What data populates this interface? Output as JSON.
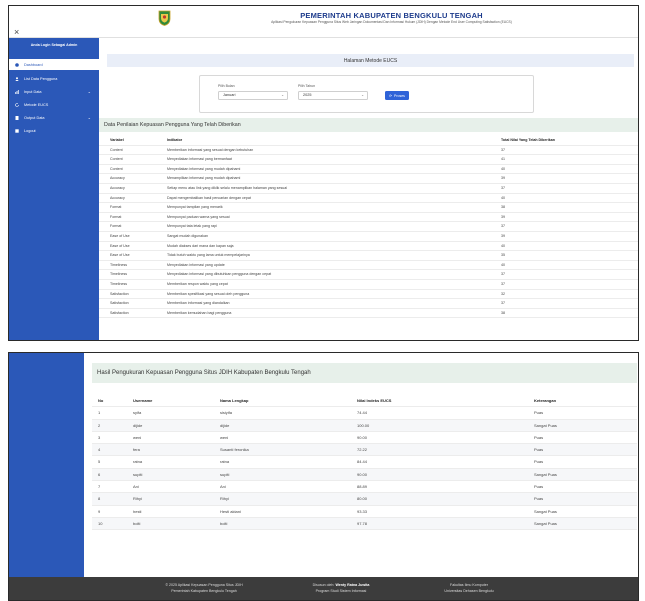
{
  "header": {
    "close_glyph": "×",
    "title": "PEMERINTAH KABUPATEN BENGKULU TENGAH",
    "subtitle": "Aplikasi Pengukuran Kepuasan Pengguna Situs Web Jaringan Dokumentasi Dan Informasi Hukum (JDIH) Dengan Metode End User Computing Satisfaction (EUCS)"
  },
  "sidebar": {
    "brand": "Anda Login Sebagai Admin",
    "items": [
      {
        "label": "Dashboard",
        "icon": "dashboard-icon"
      },
      {
        "label": "List Data Pengguna",
        "icon": "user-icon"
      },
      {
        "label": "Input Data",
        "icon": "chart-icon",
        "chevron": "⌄"
      },
      {
        "label": "Metode EUCS",
        "icon": "refresh-icon"
      },
      {
        "label": "Output Data",
        "icon": "document-icon",
        "chevron": "⌄"
      },
      {
        "label": "Logout",
        "icon": "logout-icon"
      }
    ]
  },
  "main": {
    "page_heading": "Halaman Metode EUCS",
    "filter": {
      "month_label": "Pilih Bulan",
      "month_value": "Januari",
      "year_label": "Pilih Tahun",
      "year_value": "2025",
      "button_label": "Proses"
    },
    "section_title": "Data Penilaian Kepuasan Pengguna Yang Telah Diberikan",
    "table": {
      "headers": [
        "Variabel",
        "Indikator",
        "Total Nilai Yang Telah Diberikan"
      ],
      "rows": [
        [
          "Content",
          "Memberikan informasi yang sesuai dengan kebutuhan",
          "37"
        ],
        [
          "Content",
          "Menyediakan informasi yang bermanfaat",
          "41"
        ],
        [
          "Content",
          "Menyediakan informasi yang mudah dipahami",
          "40"
        ],
        [
          "Accuracy",
          "Menampilkan informasi yang mudah dipahami",
          "39"
        ],
        [
          "Accuracy",
          "Setiap menu atau link yang diklik selalu menampilkan halaman yang sesuai",
          "37"
        ],
        [
          "Accuracy",
          "Dapat mengembalikan hasil pencarian dengan cepat",
          "40"
        ],
        [
          "Format",
          "Mempunyai tampilan yang menarik",
          "38"
        ],
        [
          "Format",
          "Mempunyai paduan warna yang sesuai",
          "39"
        ],
        [
          "Format",
          "Mempunyai tata letak yang rapi",
          "37"
        ],
        [
          "Ease of Use",
          "Sangat mudah digunakan",
          "39"
        ],
        [
          "Ease of Use",
          "Mudah diakses dari mana dan kapan saja",
          "40"
        ],
        [
          "Ease of Use",
          "Tidak butuh waktu yang lama untuk mempelajarinya",
          "35"
        ],
        [
          "Timeliness",
          "Menyediakan informasi yang update",
          "40"
        ],
        [
          "Timeliness",
          "Menyediakan informasi yang dibutuhkan pengguna dengan cepat",
          "37"
        ],
        [
          "Timeliness",
          "Memberikan respon waktu yang cepat",
          "37"
        ],
        [
          "Satisfaction",
          "Memberikan spesifikasi yang sesuai oleh pengguna",
          "32"
        ],
        [
          "Satisfaction",
          "Memberikan informasi yang diandalkan",
          "37"
        ],
        [
          "Satisfaction",
          "Memberikan kemudahan bagi pengguna",
          "38"
        ]
      ]
    }
  },
  "results": {
    "section_title": "Hasil Pengukuran Kepuasan Pengguna Situs JDIH Kabupaten Bengkulu Tengah",
    "headers": [
      "No",
      "Username",
      "Nama Lengkap",
      "Nilai Indeks EUCS",
      "Keterangan"
    ],
    "rows": [
      [
        "1",
        "syifa",
        "sisiyifa",
        "74.44",
        "Puas"
      ],
      [
        "2",
        "dijide",
        "dijide",
        "100.00",
        "Sangat Puas"
      ],
      [
        "3",
        "weni",
        "weni",
        "90.00",
        "Puas"
      ],
      [
        "4",
        "fera",
        "Susanti feronika",
        "72.22",
        "Puas"
      ],
      [
        "5",
        "ratna",
        "ratna",
        "84.44",
        "Puas"
      ],
      [
        "6",
        "supiti",
        "supiti",
        "90.00",
        "Sangat Puas"
      ],
      [
        "7",
        "Ani",
        "Ani",
        "88.89",
        "Puas"
      ],
      [
        "8",
        "Rihyi",
        "Rihyi",
        "80.00",
        "Puas"
      ],
      [
        "9",
        "hesti",
        "Hesti aktani",
        "93.33",
        "Sangat Puas"
      ],
      [
        "10",
        "bolti",
        "bolti",
        "97.78",
        "Sangat Puas"
      ]
    ]
  },
  "footer": {
    "col1_line1": "© 2025 Aplikasi Kepuasan Pengguna Situs JDIH",
    "col1_line2": "Pemerintah Kabupaten Bengkulu Tengah",
    "col2_prefix": "Disusun oleh:",
    "col2_name": "Wenty Ratna Juwita",
    "col2_line2": "Program Studi Sistem Informasi",
    "col3_line1": "Fakultas Ilmu Komputer",
    "col3_line2": "Universitas Dehasen Bengkulu"
  },
  "colors": {
    "sidebar": "#2b58b8",
    "title": "#1d3b8c",
    "button": "#2f63d8",
    "section_head": "#e7f0ea",
    "footer": "#3c3c3c"
  }
}
